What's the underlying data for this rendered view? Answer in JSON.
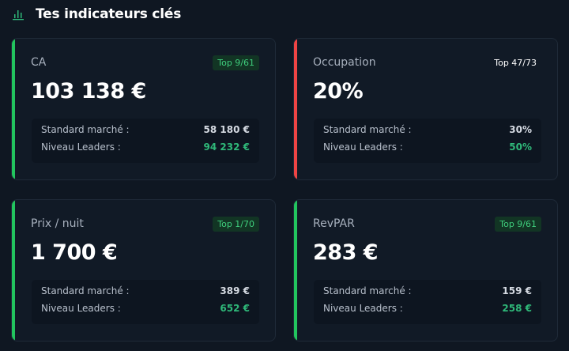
{
  "header": {
    "title": "Tes indicateurs clés",
    "icon": "bar-chart-icon"
  },
  "colors": {
    "good": "#22c55e",
    "bad": "#ef4444",
    "leaders": "#2fb879"
  },
  "cards": [
    {
      "label": "CA",
      "badge": "Top 9/61",
      "status": "good",
      "value": "103 138 €",
      "market_label": "Standard marché :",
      "market_value": "58 180 €",
      "leaders_label": "Niveau Leaders :",
      "leaders_value": "94 232 €"
    },
    {
      "label": "Occupation",
      "badge": "Top 47/73",
      "status": "bad",
      "value": "20%",
      "market_label": "Standard marché :",
      "market_value": "30%",
      "leaders_label": "Niveau Leaders :",
      "leaders_value": "50%"
    },
    {
      "label": "Prix / nuit",
      "badge": "Top 1/70",
      "status": "good",
      "value": "1 700 €",
      "market_label": "Standard marché :",
      "market_value": "389 €",
      "leaders_label": "Niveau Leaders :",
      "leaders_value": "652 €"
    },
    {
      "label": "RevPAR",
      "badge": "Top 9/61",
      "status": "good",
      "value": "283 €",
      "market_label": "Standard marché :",
      "market_value": "159 €",
      "leaders_label": "Niveau Leaders :",
      "leaders_value": "258 €"
    }
  ]
}
